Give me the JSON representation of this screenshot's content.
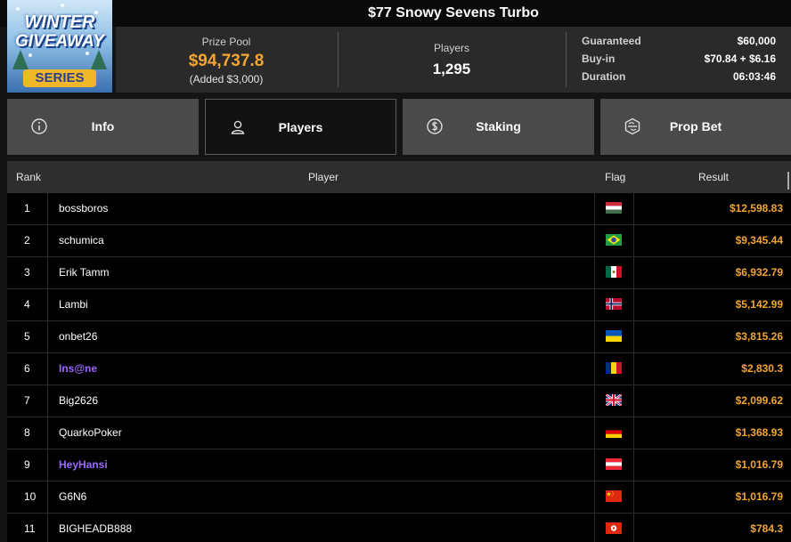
{
  "header": {
    "title": "$77 Snowy Sevens Turbo"
  },
  "logo": {
    "line1": "WINTER",
    "line2": "GIVEAWAY",
    "line3": "SERIES"
  },
  "stats": {
    "prize_pool_label": "Prize Pool",
    "prize_pool_value": "$94,737.8",
    "prize_pool_added": "(Added $3,000)",
    "players_label": "Players",
    "players_value": "1,295",
    "details": [
      {
        "label": "Guaranteed",
        "value": "$60,000"
      },
      {
        "label": "Buy-in",
        "value": "$70.84 + $6.16"
      },
      {
        "label": "Duration",
        "value": "06:03:46"
      }
    ]
  },
  "tabs": [
    {
      "label": "Info",
      "icon": "info-icon",
      "active": false
    },
    {
      "label": "Players",
      "icon": "user-icon",
      "active": true
    },
    {
      "label": "Staking",
      "icon": "dollar-coin-icon",
      "active": false
    },
    {
      "label": "Prop Bet",
      "icon": "prop-bet-icon",
      "active": false
    }
  ],
  "table": {
    "columns": {
      "rank": "Rank",
      "player": "Player",
      "flag": "Flag",
      "result": "Result"
    },
    "rows": [
      {
        "rank": "1",
        "player": "bossboros",
        "flag": "hungary",
        "result": "$12,598.83",
        "highlight": false
      },
      {
        "rank": "2",
        "player": "schumica",
        "flag": "brazil",
        "result": "$9,345.44",
        "highlight": false
      },
      {
        "rank": "3",
        "player": "Erik Tamm",
        "flag": "mexico",
        "result": "$6,932.79",
        "highlight": false
      },
      {
        "rank": "4",
        "player": "Lambi",
        "flag": "norway",
        "result": "$5,142.99",
        "highlight": false
      },
      {
        "rank": "5",
        "player": "onbet26",
        "flag": "ukraine",
        "result": "$3,815.26",
        "highlight": false
      },
      {
        "rank": "6",
        "player": "Ins@ne",
        "flag": "romania",
        "result": "$2,830.3",
        "highlight": true
      },
      {
        "rank": "7",
        "player": "Big2626",
        "flag": "united-kingdom",
        "result": "$2,099.62",
        "highlight": false
      },
      {
        "rank": "8",
        "player": "QuarkoPoker",
        "flag": "germany",
        "result": "$1,368.93",
        "highlight": false
      },
      {
        "rank": "9",
        "player": "HeyHansi",
        "flag": "austria",
        "result": "$1,016.79",
        "highlight": true
      },
      {
        "rank": "10",
        "player": "G6N6",
        "flag": "china",
        "result": "$1,016.79",
        "highlight": false
      },
      {
        "rank": "11",
        "player": "BIGHEADB888",
        "flag": "hong-kong",
        "result": "$784.3",
        "highlight": false
      }
    ]
  },
  "colors": {
    "accent": "#f2a531",
    "highlight_player": "#9a68ff",
    "active_tab": "#121212",
    "inactive_tab": "#4a4a4a"
  }
}
